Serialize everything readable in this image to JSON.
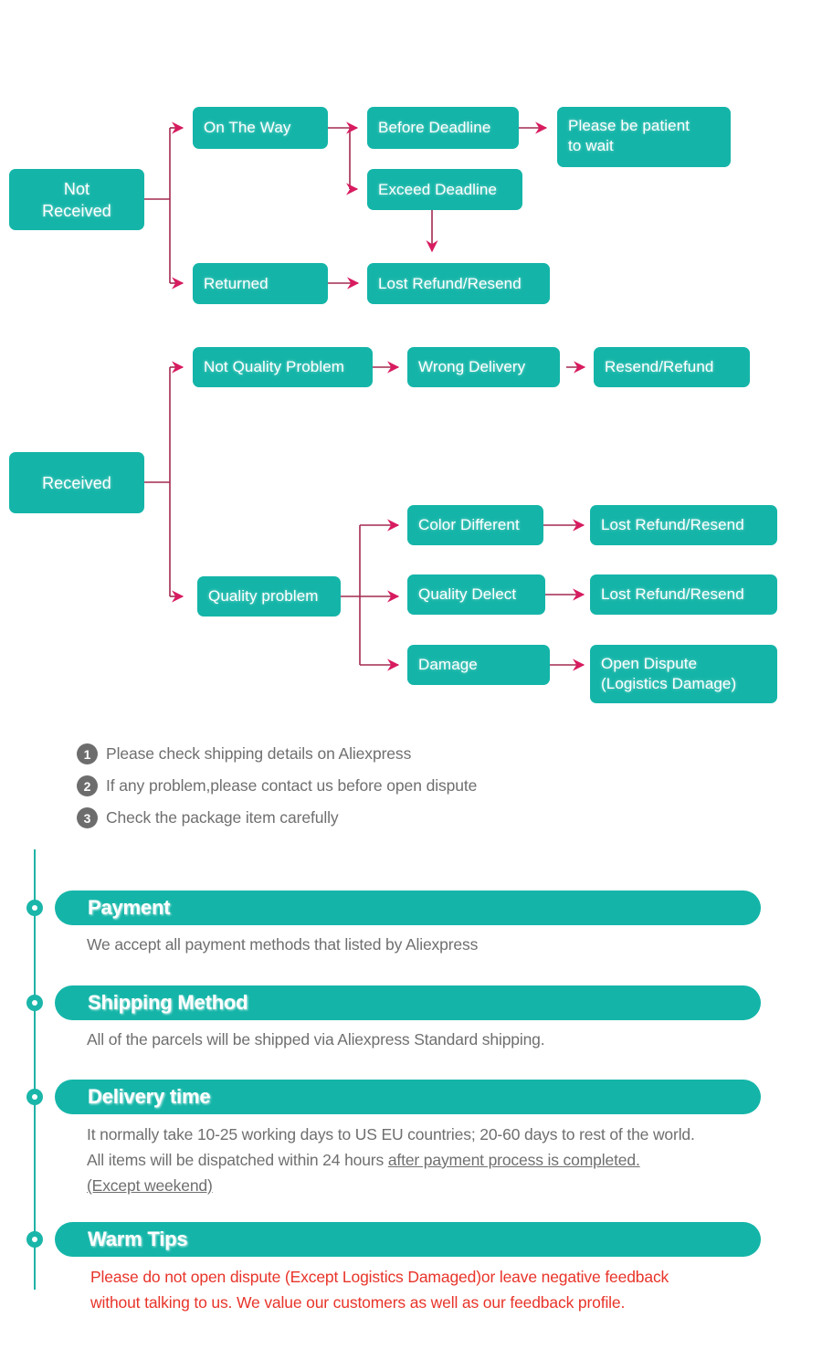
{
  "colors": {
    "node_teal": "#14b5a8",
    "arrow_crimson": "#d81b5f",
    "connector_maroon": "#a32a50",
    "note_badge_gray": "#6d6d6d",
    "body_text_gray": "#6f6f6f",
    "warning_red": "#e8342a",
    "timeline_teal": "#1fb3a6"
  },
  "flow": {
    "not_received": {
      "root": "Not\nReceived",
      "root_line1": "Not",
      "root_line2": "Received",
      "on_the_way": "On The Way",
      "before_deadline": "Before Deadline",
      "please_be_patient": "Please be patient\nto wait",
      "please_be_patient_line1": "Please be patient",
      "please_be_patient_line2": "to wait",
      "exceed_deadline": "Exceed Deadline",
      "returned": "Returned",
      "lost_refund_resend": "Lost Refund/Resend"
    },
    "received": {
      "root": "Received",
      "not_quality_problem": "Not Quality Problem",
      "wrong_delivery": "Wrong Delivery",
      "resend_refund": "Resend/Refund",
      "quality_problem": "Quality problem",
      "color_different": "Color Different",
      "color_different_result": "Lost Refund/Resend",
      "quality_delect": "Quality Delect",
      "quality_delect_result": "Lost Refund/Resend",
      "damage": "Damage",
      "damage_result": "Open Dispute\n(Logistics Damage)",
      "damage_result_line1": "Open Dispute",
      "damage_result_line2": "(Logistics Damage)"
    }
  },
  "notes": [
    {
      "number": "1",
      "text": "Please check shipping details on Aliexpress"
    },
    {
      "number": "2",
      "text": "If any problem,please contact us before open dispute"
    },
    {
      "number": "3",
      "text": "Check the package item carefully"
    }
  ],
  "sections": [
    {
      "title": "Payment",
      "body_lines": [
        "We accept all payment methods that listed by Aliexpress"
      ]
    },
    {
      "title": "Shipping Method",
      "body_lines": [
        "All of the parcels will be shipped via Aliexpress Standard shipping."
      ]
    },
    {
      "title": "Delivery time",
      "body_lines": [
        "It normally take 10-25 working days to US EU countries; 20-60 days to rest of the world.",
        "All items will be dispatched within 24 hours ",
        "after payment process is completed.",
        "(Except weekend)"
      ],
      "line2_plain": "All items will be dispatched within 24 hours ",
      "line2_underlined": "after payment process is completed.",
      "line3_underlined": "(Except weekend)"
    },
    {
      "title": "Warm Tips",
      "body_lines": [
        "Please do not open dispute (Except Logistics Damaged)or leave negative feedback",
        "without talking to us. We value our customers as well as our feedback profile."
      ]
    }
  ]
}
